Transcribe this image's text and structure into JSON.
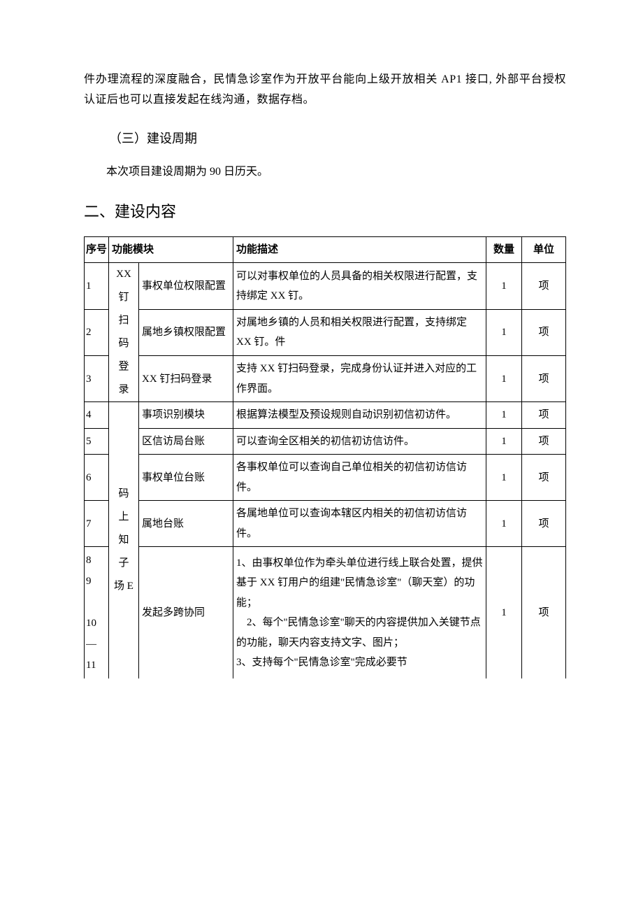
{
  "intro_para": "件办理流程的深度融合，民情急诊室作为开放平台能向上级开放相关 AP1 接口, 外部平台授权认证后也可以直接发起在线沟通，数据存档。",
  "subheading": "（三）建设周期",
  "period_line": "本次项目建设周期为 90 日历天。",
  "section_heading": "二、建设内容",
  "table": {
    "headers": {
      "sn": "序号",
      "module": "功能模块",
      "desc": "功能描述",
      "qty": "数量",
      "unit": "单位"
    },
    "category1": "XX 钉 扫 码 登 录",
    "category2": "码 上 知 子 场 E",
    "left_sn_group": "8\n9\n\n10\n—\n11",
    "rows": [
      {
        "sn": "1",
        "module": "事权单位权限配置",
        "desc": "可以对事权单位的人员具备的相关权限进行配置，支持绑定 XX 钉。",
        "qty": "1",
        "unit": "项"
      },
      {
        "sn": "2",
        "module": "属地乡镇权限配置",
        "desc": "对属地乡镇的人员和相关权限进行配置，支持绑定 XX 钉。件",
        "qty": "1",
        "unit": "项"
      },
      {
        "sn": "3",
        "module": "XX 钉扫码登录",
        "desc": "支持 XX 钉扫码登录，完成身份认证并进入对应的工作界面。",
        "qty": "1",
        "unit": "项"
      },
      {
        "sn": "4",
        "module": "事项识别模块",
        "desc": "根据算法模型及预设规则自动识别初信初访件。",
        "qty": "1",
        "unit": "项"
      },
      {
        "sn": "5",
        "module": "区信访局台账",
        "desc": "可以查询全区相关的初信初访信访件。",
        "qty": "1",
        "unit": "项"
      },
      {
        "sn": "6",
        "module": "事权单位台账",
        "desc": "各事权单位可以查询自己单位相关的初信初访信访件。",
        "qty": "1",
        "unit": "项"
      },
      {
        "sn": "7",
        "module": "属地台账",
        "desc": "各属地单位可以查询本辖区内相关的初信初访信访件。",
        "qty": "1",
        "unit": "项"
      },
      {
        "sn": "",
        "module": "发起多跨协同",
        "desc": "1、由事权单位作为牵头单位进行线上联合处置，提供基于 XX 钉用户的组建\"民情急诊室\"（聊天室）的功能；\n　2、每个\"民情急诊室\"聊天的内容提供加入关键节点的功能，聊天内容支持文字、图片；\n3、支持每个\"民情急诊室\"完成必要节",
        "qty": "1",
        "unit": "项"
      }
    ]
  }
}
